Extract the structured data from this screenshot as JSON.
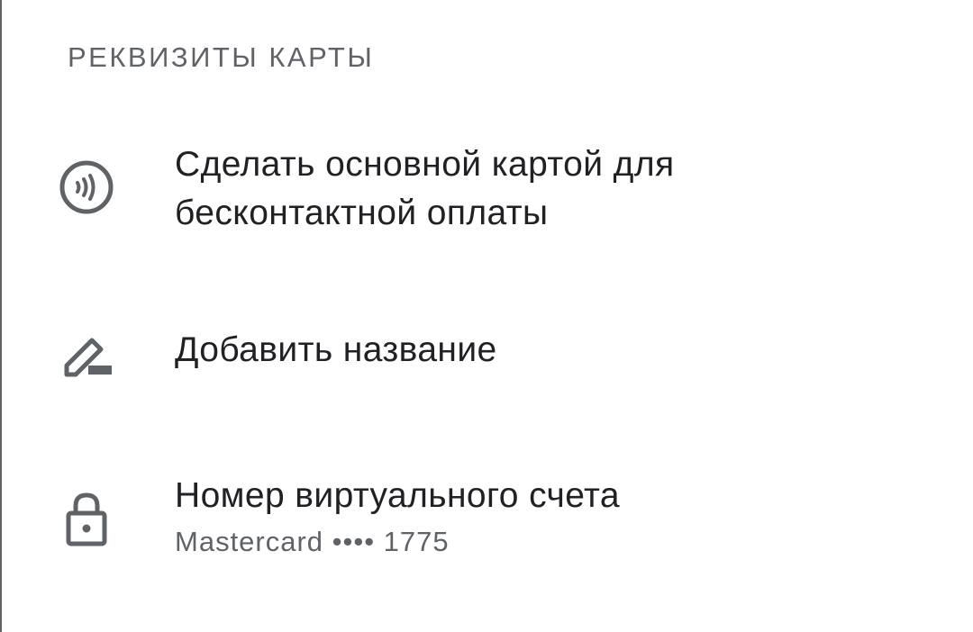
{
  "section": {
    "header": "РЕКВИЗИТЫ КАРТЫ"
  },
  "items": [
    {
      "icon": "contactless-icon",
      "title_line1": "Сделать основной картой для",
      "title_line2": "бесконтактной оплаты"
    },
    {
      "icon": "edit-icon",
      "title": "Добавить название"
    },
    {
      "icon": "lock-icon",
      "title": "Номер виртуального счета",
      "subtitle": "Mastercard •••• 1775"
    }
  ],
  "colors": {
    "primary_text": "#202124",
    "secondary_text": "#5f6368",
    "icon": "#5f6368",
    "background": "#ffffff"
  }
}
